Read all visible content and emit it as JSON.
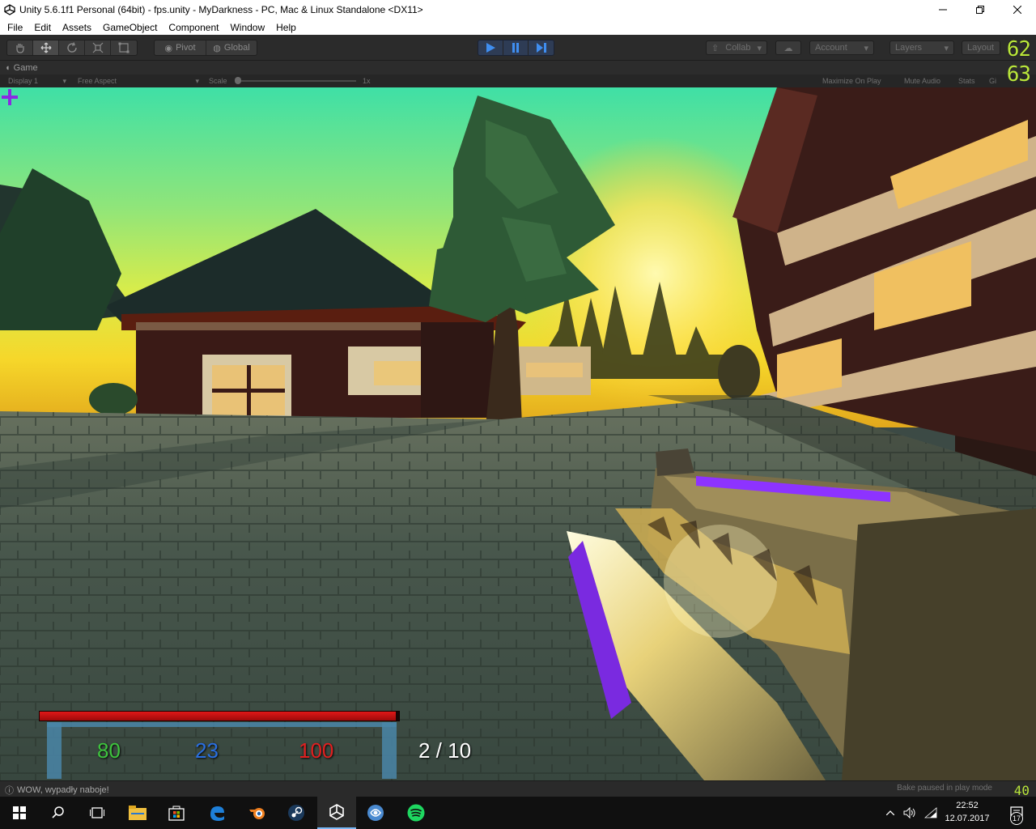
{
  "window": {
    "title": "Unity 5.6.1f1 Personal (64bit) - fps.unity - MyDarkness - PC, Mac & Linux Standalone <DX11>",
    "minimize_icon": "minimize-icon",
    "maximize_icon": "restore-icon",
    "close_icon": "close-icon"
  },
  "menu": [
    "File",
    "Edit",
    "Assets",
    "GameObject",
    "Component",
    "Window",
    "Help"
  ],
  "toolbar": {
    "tools": [
      "hand-icon",
      "move-icon",
      "rotate-icon",
      "scale-icon",
      "rect-icon"
    ],
    "pivot_label": "Pivot",
    "global_label": "Global",
    "play_controls": [
      "play-icon",
      "pause-icon",
      "step-icon"
    ],
    "collab_label": "Collab",
    "account_label": "Account",
    "layers_label": "Layers",
    "layout_label": "Layout"
  },
  "fps_counter": {
    "top": "62",
    "second": "63",
    "bottom": "40"
  },
  "game_tab": {
    "label": "Game",
    "display": "Display 1",
    "aspect": "Free Aspect",
    "scale_label": "Scale",
    "scale_value": "1x",
    "maximize_on_play": "Maximize On Play",
    "mute_audio": "Mute Audio",
    "stats": "Stats",
    "gizmos": "Gi"
  },
  "hud": {
    "health": "80",
    "armor": "23",
    "stamina": "100",
    "ammo": "2 / 10",
    "bar_fill_fraction": 0.99,
    "colors": {
      "health": "#3ec43e",
      "armor": "#2a6fe0",
      "stamina": "#e02020",
      "bar": "#e01818",
      "crosshair": "#8a2be2"
    }
  },
  "console": {
    "message": "WOW, wypadły naboje!",
    "status": "Bake paused in play mode"
  },
  "taskbar": {
    "apps": [
      "start-icon",
      "search-icon",
      "task-view-icon",
      "file-explorer-icon",
      "store-icon",
      "edge-icon",
      "blender-icon",
      "steam-icon",
      "unity-icon",
      "app-icon",
      "spotify-icon"
    ],
    "time": "22:52",
    "date": "12.07.2017",
    "notifications": "17"
  }
}
